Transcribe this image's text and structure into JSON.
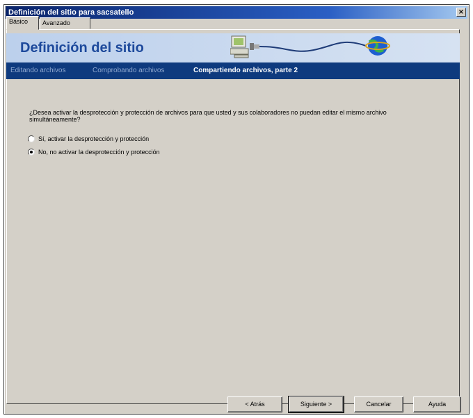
{
  "window": {
    "title": "Definición del sitio para sacsatello",
    "close_glyph": "×"
  },
  "tabs": [
    {
      "label": "Básico",
      "active": true
    },
    {
      "label": "Avanzado",
      "active": false
    }
  ],
  "banner": {
    "title": "Definición del sitio"
  },
  "steps": [
    {
      "label": "Editando archivos",
      "current": false
    },
    {
      "label": "Comprobando archivos",
      "current": false
    },
    {
      "label": "Compartiendo archivos, parte 2",
      "current": true
    }
  ],
  "question": "¿Desea activar la desprotección y protección de archivos para que usted y sus colaboradores no puedan editar el mismo archivo simultáneamente?",
  "options": [
    {
      "label": "Sí, activar la desprotección y protección",
      "selected": false
    },
    {
      "label": "No, no activar la desprotección y protección",
      "selected": true
    }
  ],
  "buttons": {
    "back": "< Atrás",
    "next": "Siguiente >",
    "cancel": "Cancelar",
    "help": "Ayuda"
  },
  "colors": {
    "title_bar": "#0a246a",
    "banner_title": "#1e4a9c",
    "step_bar": "#0e3a7e",
    "dialog_bg": "#d4d0c8"
  },
  "icons": [
    "close-icon",
    "computer-network-globe-icon"
  ]
}
